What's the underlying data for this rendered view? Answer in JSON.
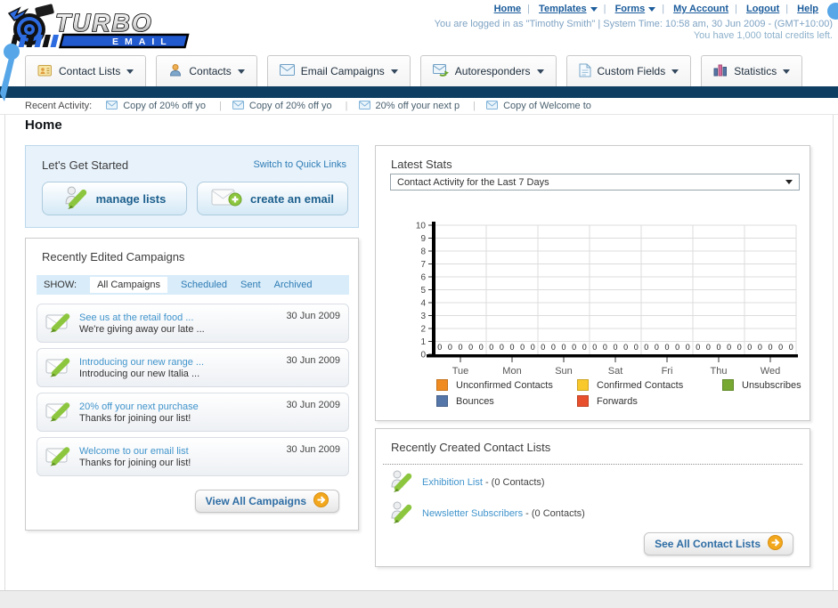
{
  "header": {
    "logo": {
      "title": "TURBO",
      "subtitle": "EMAIL"
    },
    "nav": [
      {
        "label": "Home",
        "caret": "none"
      },
      {
        "label": "Templates",
        "caret": "inline-block"
      },
      {
        "label": "Forms",
        "caret": "inline-block"
      },
      {
        "label": "My Account",
        "caret": "none"
      },
      {
        "label": "Logout",
        "caret": "none"
      },
      {
        "label": "Help",
        "caret": "none"
      }
    ],
    "login_info": "You are logged in as \"Timothy Smith\" | System Time: 10:58 am, 30 Jun 2009 - (GMT+10:00)",
    "credits_info": "You have 1,000 total credits left."
  },
  "tabs": [
    {
      "label": "Contact Lists",
      "icon": "contact-lists-icon"
    },
    {
      "label": "Contacts",
      "icon": "contacts-icon"
    },
    {
      "label": "Email Campaigns",
      "icon": "email-campaigns-icon"
    },
    {
      "label": "Autoresponders",
      "icon": "autoresponders-icon"
    },
    {
      "label": "Custom Fields",
      "icon": "custom-fields-icon"
    },
    {
      "label": "Statistics",
      "icon": "statistics-icon"
    }
  ],
  "recent_activity": {
    "label": "Recent Activity:",
    "items": [
      "Copy of 20% off yo",
      "Copy of 20% off yo",
      "20% off your next p",
      "Copy of Welcome to"
    ]
  },
  "page_title": "Home",
  "get_started": {
    "title": "Let's Get Started",
    "switch_link": "Switch to Quick Links",
    "manage_lists_label": "manage lists",
    "create_email_label": "create an email"
  },
  "campaigns": {
    "title": "Recently Edited Campaigns",
    "show_label": "SHOW:",
    "filters": [
      "All Campaigns",
      "Scheduled",
      "Sent",
      "Archived"
    ],
    "active_filter": "All Campaigns",
    "items": [
      {
        "title": "See us at the retail food ...",
        "subtitle": "We're giving away our late ...",
        "date": "30 Jun 2009"
      },
      {
        "title": "Introducing our new range ...",
        "subtitle": "Introducing our new Italia ...",
        "date": "30 Jun 2009"
      },
      {
        "title": "20% off your next purchase",
        "subtitle": "Thanks for joining our list!",
        "date": "30 Jun 2009"
      },
      {
        "title": "Welcome to our email list",
        "subtitle": "Thanks for joining our list!",
        "date": "30 Jun 2009"
      }
    ],
    "view_all_label": "View All Campaigns"
  },
  "stats": {
    "title": "Latest Stats",
    "dropdown_value": "Contact Activity for the Last 7 Days"
  },
  "chart_data": {
    "type": "bar",
    "title": "Contact Activity for the Last 7 Days",
    "categories": [
      "Tue",
      "Mon",
      "Sun",
      "Sat",
      "Fri",
      "Thu",
      "Wed"
    ],
    "series": [
      {
        "name": "Unconfirmed Contacts",
        "color": "#f08b22",
        "values": [
          0,
          0,
          0,
          0,
          0,
          0,
          0
        ]
      },
      {
        "name": "Confirmed Contacts",
        "color": "#f9c82b",
        "values": [
          0,
          0,
          0,
          0,
          0,
          0,
          0
        ]
      },
      {
        "name": "Unsubscribes",
        "color": "#76a832",
        "values": [
          0,
          0,
          0,
          0,
          0,
          0,
          0
        ]
      },
      {
        "name": "Bounces",
        "color": "#5576a8",
        "values": [
          0,
          0,
          0,
          0,
          0,
          0,
          0
        ]
      },
      {
        "name": "Forwards",
        "color": "#e8502d",
        "values": [
          0,
          0,
          0,
          0,
          0,
          0,
          0
        ]
      }
    ],
    "ylim": [
      0,
      10
    ],
    "yticks": [
      0,
      1,
      2,
      3,
      4,
      5,
      6,
      7,
      8,
      9,
      10
    ],
    "grid": true,
    "value_labels": true,
    "legend_position": "bottom"
  },
  "contact_lists": {
    "title": "Recently Created Contact Lists",
    "items": [
      {
        "name": "Exhibition List",
        "detail": "- (0 Contacts)"
      },
      {
        "name": "Newsletter Subscribers",
        "detail": "- (0 Contacts)"
      }
    ],
    "see_all_label": "See All Contact Lists"
  }
}
